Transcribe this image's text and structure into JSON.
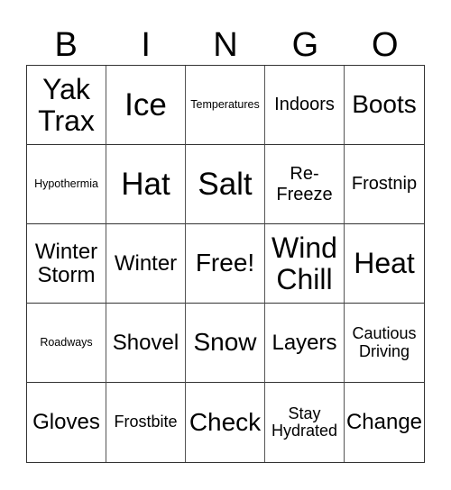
{
  "header": [
    "B",
    "I",
    "N",
    "G",
    "O"
  ],
  "cells": [
    {
      "text": "Yak Trax",
      "size": "s-xxl"
    },
    {
      "text": "Ice",
      "size": "s-xxxl"
    },
    {
      "text": "Temperatures",
      "size": "s-xs"
    },
    {
      "text": "Indoors",
      "size": "s-md"
    },
    {
      "text": "Boots",
      "size": "s-xl"
    },
    {
      "text": "Hypothermia",
      "size": "s-xs"
    },
    {
      "text": "Hat",
      "size": "s-xxxl"
    },
    {
      "text": "Salt",
      "size": "s-xxxl"
    },
    {
      "text": "Re-Freeze",
      "size": "s-md"
    },
    {
      "text": "Frostnip",
      "size": "s-md"
    },
    {
      "text": "Winter Storm",
      "size": "s-lg"
    },
    {
      "text": "Winter",
      "size": "s-lg"
    },
    {
      "text": "Free!",
      "size": "s-xl"
    },
    {
      "text": "Wind Chill",
      "size": "s-xxl"
    },
    {
      "text": "Heat",
      "size": "s-xxl"
    },
    {
      "text": "Roadways",
      "size": "s-xs"
    },
    {
      "text": "Shovel",
      "size": "s-lg"
    },
    {
      "text": "Snow",
      "size": "s-xl"
    },
    {
      "text": "Layers",
      "size": "s-lg"
    },
    {
      "text": "Cautious Driving",
      "size": "s-sm"
    },
    {
      "text": "Gloves",
      "size": "s-lg"
    },
    {
      "text": "Frostbite",
      "size": "s-sm"
    },
    {
      "text": "Check",
      "size": "s-xl"
    },
    {
      "text": "Stay Hydrated",
      "size": "s-sm"
    },
    {
      "text": "Change",
      "size": "s-lg"
    }
  ]
}
